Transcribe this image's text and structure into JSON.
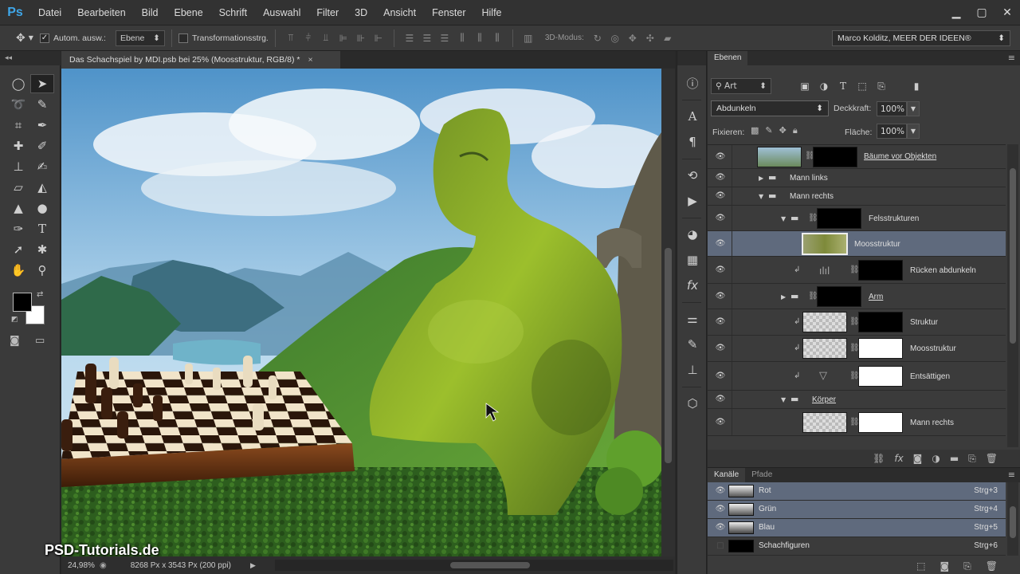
{
  "app": {
    "logo": "Ps"
  },
  "menu": [
    "Datei",
    "Bearbeiten",
    "Bild",
    "Ebene",
    "Schrift",
    "Auswahl",
    "Filter",
    "3D",
    "Ansicht",
    "Fenster",
    "Hilfe"
  ],
  "window_controls": {
    "minimize": "▁",
    "maximize": "▢",
    "close": "✕"
  },
  "options": {
    "auto_select_label": "Autom. ausw.:",
    "auto_select_value": "Ebene",
    "transform_label": "Transformationsstrg.",
    "mode_3d_label": "3D-Modus:",
    "workspace": "Marco Kolditz, MEER DER IDEEN®"
  },
  "document": {
    "tab_title": "Das Schachspiel by MDI.psb bei 25% (Moosstruktur, RGB/8) *",
    "tab_close": "×",
    "watermark": "PSD-Tutorials.de"
  },
  "status": {
    "zoom": "24,98%",
    "doc_info": "8268 Px x 3543 Px (200 ppi)"
  },
  "layers_panel": {
    "tab": "Ebenen",
    "kind_filter": "Art",
    "blend_mode": "Abdunkeln",
    "opacity_label": "Deckkraft:",
    "opacity_value": "100%",
    "lock_label": "Fixieren:",
    "fill_label": "Fläche:",
    "fill_value": "100%",
    "layers": [
      {
        "name": "Bäume vor Objekten"
      },
      {
        "name": "Mann links"
      },
      {
        "name": "Mann rechts"
      },
      {
        "name": "Felsstrukturen"
      },
      {
        "name": "Moosstruktur"
      },
      {
        "name": "Rücken abdunkeln"
      },
      {
        "name": "Arm"
      },
      {
        "name": "Struktur"
      },
      {
        "name": "Moosstruktur"
      },
      {
        "name": "Entsättigen"
      },
      {
        "name": "Körper"
      },
      {
        "name": "Mann rechts"
      }
    ]
  },
  "channels_panel": {
    "tabs": [
      "Kanäle",
      "Pfade"
    ],
    "channels": [
      {
        "name": "Rot",
        "shortcut": "Strg+3"
      },
      {
        "name": "Grün",
        "shortcut": "Strg+4"
      },
      {
        "name": "Blau",
        "shortcut": "Strg+5"
      },
      {
        "name": "Schachfiguren",
        "shortcut": "Strg+6"
      }
    ]
  }
}
